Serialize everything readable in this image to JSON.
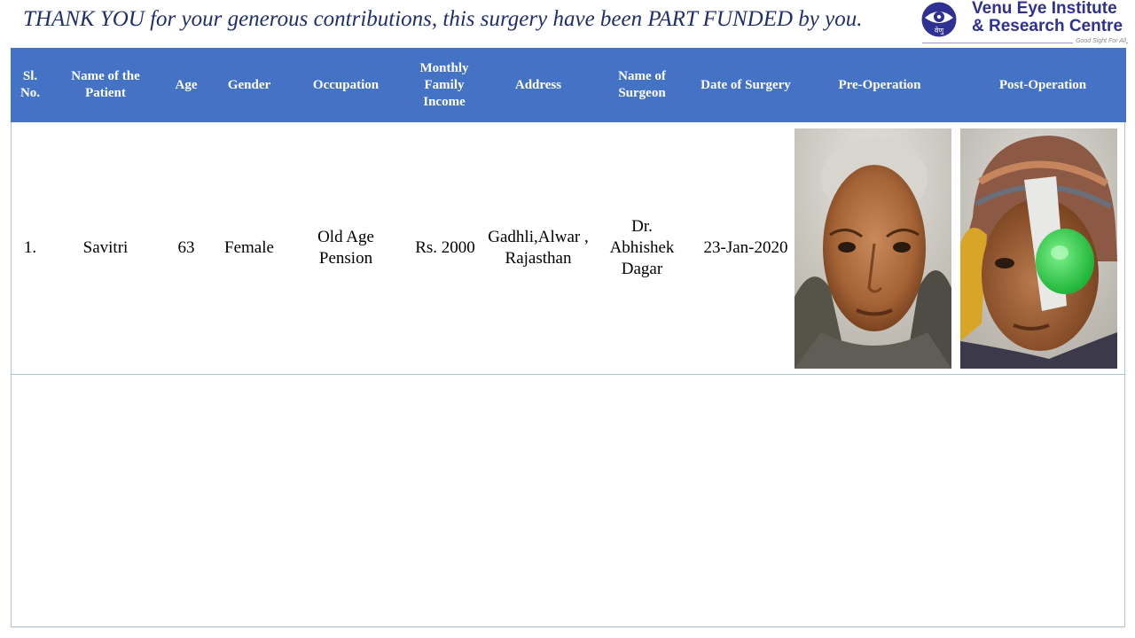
{
  "headline": "THANK YOU for your generous contributions, this surgery have been PART  FUNDED by you.",
  "logo": {
    "line1": "Venu Eye Institute",
    "line2": "& Research Centre",
    "tagline": "Good Sight For All",
    "mark_text": "वेणु"
  },
  "table": {
    "headers": {
      "sl_no": "Sl. No.",
      "name": "Name of the Patient",
      "age": "Age",
      "gender": "Gender",
      "occupation": "Occupation",
      "income": "Monthly Family Income",
      "address": "Address",
      "surgeon": "Name of Surgeon",
      "date": "Date of Surgery",
      "pre_op": "Pre-Operation",
      "post_op": "Post-Operation"
    },
    "rows": [
      {
        "sl_no": "1.",
        "name": "Savitri",
        "age": "63",
        "gender": "Female",
        "occupation": "Old Age Pension",
        "income": "Rs. 2000",
        "address": "Gadhli,Alwar , Rajasthan",
        "surgeon": "Dr. Abhishek Dagar",
        "date": "23-Jan-2020"
      }
    ]
  },
  "colors": {
    "header_bg": "#4472c4",
    "headline_text": "#1f2f6b",
    "brand": "#2e3191",
    "border": "#b0c1d4"
  }
}
